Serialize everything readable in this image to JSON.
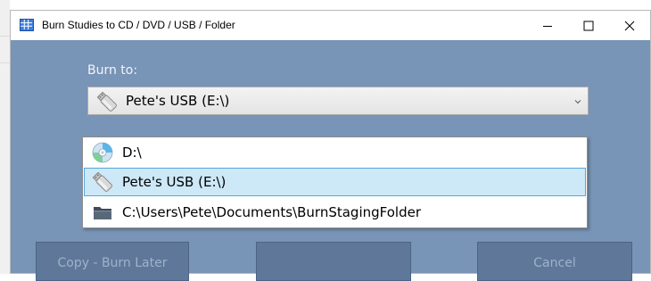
{
  "window": {
    "title": "Burn Studies to CD / DVD / USB / Folder",
    "icon": "app-grid-icon",
    "controls": {
      "minimize_icon": "minimize-icon",
      "maximize_icon": "maximize-icon",
      "close_icon": "close-icon"
    }
  },
  "form": {
    "burn_to_label": "Burn to:",
    "selected_destination": "Pete's USB (E:\\)",
    "selected_icon": "usb-drive-icon"
  },
  "dropdown": {
    "options": [
      {
        "label": "D:\\",
        "icon": "cd-disc-icon",
        "selected": false
      },
      {
        "label": "Pete's USB (E:\\)",
        "icon": "usb-drive-icon",
        "selected": true
      },
      {
        "label": "C:\\Users\\Pete\\Documents\\BurnStagingFolder",
        "icon": "folder-icon",
        "selected": false
      }
    ]
  },
  "buttons": {
    "copy_burn_later": "Copy - Burn Later",
    "burn": "",
    "cancel": "Cancel"
  },
  "colors": {
    "content_background": "#7894b6",
    "button_background": "#5f7899",
    "selection_background": "#cde8f7",
    "selection_border": "#54a8dd"
  }
}
